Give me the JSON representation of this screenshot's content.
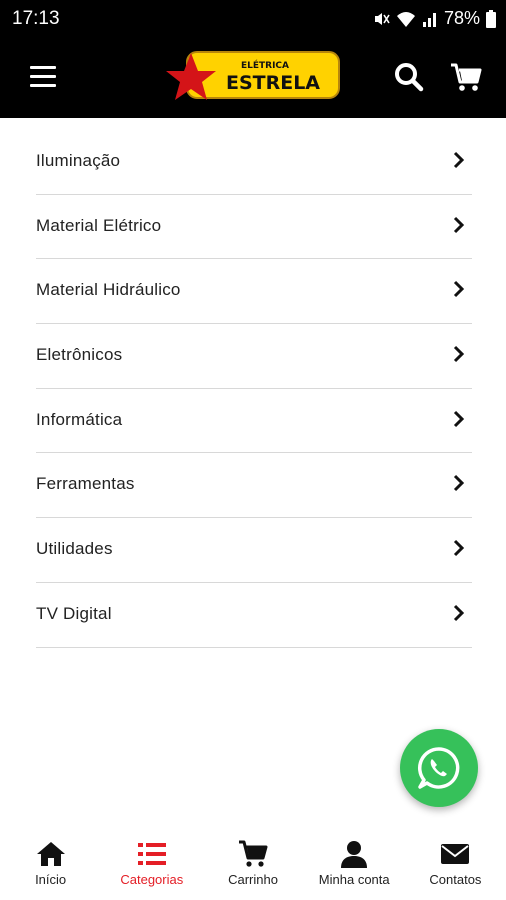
{
  "status_bar": {
    "time": "17:13",
    "battery": "78%"
  },
  "header": {
    "logo_line1": "ELÉTRICA",
    "logo_line2": "ESTRELA"
  },
  "categories": [
    {
      "label": "Iluminação"
    },
    {
      "label": "Material Elétrico"
    },
    {
      "label": "Material Hidráulico"
    },
    {
      "label": "Eletrônicos"
    },
    {
      "label": "Informática"
    },
    {
      "label": "Ferramentas"
    },
    {
      "label": "Utilidades"
    },
    {
      "label": "TV Digital"
    }
  ],
  "bottom_nav": {
    "items": [
      {
        "label": "Início",
        "icon": "home-icon"
      },
      {
        "label": "Categorias",
        "icon": "list-icon",
        "active": true
      },
      {
        "label": "Carrinho",
        "icon": "cart-icon"
      },
      {
        "label": "Minha conta",
        "icon": "user-icon"
      },
      {
        "label": "Contatos",
        "icon": "mail-icon"
      }
    ]
  },
  "colors": {
    "bar_bg": "#000000",
    "accent_red": "#e41e26",
    "logo_yellow": "#ffd200",
    "whatsapp_green": "#36c15a"
  }
}
